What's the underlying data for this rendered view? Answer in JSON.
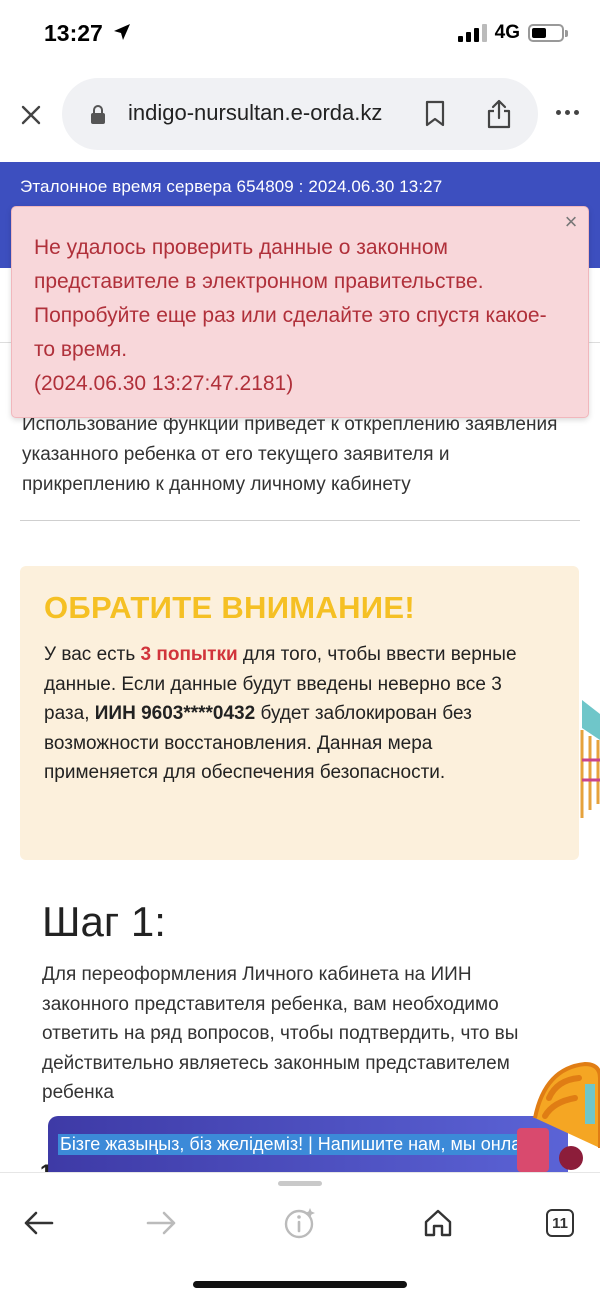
{
  "status_bar": {
    "time": "13:27",
    "network": "4G"
  },
  "browser": {
    "url": "indigo-nursultan.e-orda.kz",
    "icons": [
      "close-icon",
      "lock-icon",
      "bookmark-icon",
      "share-icon",
      "more-icon"
    ]
  },
  "page": {
    "server_time": "Эталонное время сервера 654809 : 2024.06.30 13:27",
    "intro_text": "Использование функции приведет к откреплению заявления указанного ребенка от его текущего заявителя и прикреплению к данному личному кабинету",
    "attention": {
      "title": "ОБРАТИТЕ ВНИМАНИЕ!",
      "part1": "У вас есть ",
      "attempts": "3 попытки",
      "part2": " для того, чтобы ввести верные данные. Если данные будут введены неверно все 3 раза, ",
      "iin": "ИИН 9603****0432",
      "part3": " будет заблокирован без возможности восстановления. Данная мера применяется для обеспечения безопасности."
    },
    "step": {
      "title": "Шаг 1:",
      "body": "Для переоформления Личного кабинета на ИИН законного представителя ребенка, вам необходимо ответить на ряд вопросов, чтобы подтвердить, что вы действительно являетесь законным представителем ребенка"
    },
    "chat_banner": "Бізге жазыңыз, біз желідеміз! | Напишите нам, мы онлайн!",
    "partial_item": "1"
  },
  "alert": {
    "message": "Не удалось проверить данные о законном представителе в электронном правительстве. Попробуйте еще раз или сделайте это спустя какое-то время.",
    "timestamp": "(2024.06.30 13:27:47.2181)",
    "close_glyph": "×"
  },
  "toolbar": {
    "tabs_count": "11",
    "icons": [
      "back-icon",
      "forward-icon",
      "info-icon",
      "home-icon",
      "tabs-icon"
    ]
  },
  "colors": {
    "header_blue": "#3d4fbf",
    "alert_bg": "#f8d7da",
    "alert_text": "#b0303a",
    "attention_bg": "#fcf0dc",
    "attention_title": "#f5c024",
    "attempts_red": "#d1343b"
  }
}
